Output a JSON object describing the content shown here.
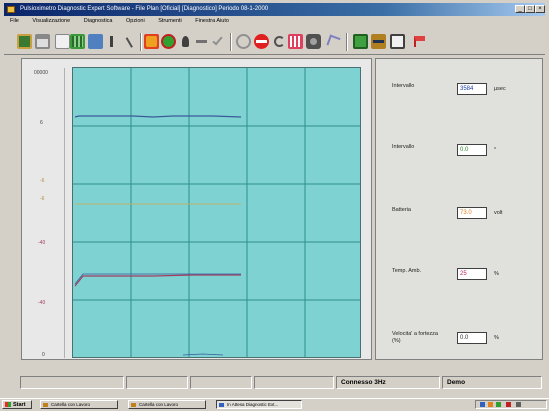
{
  "window": {
    "title": "Pulsioximetro Diagnostic Expert Software - File Plan [Oficial] [Diagnostico] Periodo 08-1-2000",
    "controls": [
      "_",
      "□",
      "×"
    ]
  },
  "menubar": [
    "File",
    "Visualizzazione",
    "Diagnostica",
    "Opzioni",
    "Strumenti",
    "Finestra Aiuto"
  ],
  "toolbar": {
    "icons": [
      "save-icon",
      "print-icon",
      "open-icon",
      "table-icon",
      "grid-icon",
      "filter-icon",
      "pen-icon",
      "record-icon",
      "globe-icon",
      "run-icon",
      "minus-icon",
      "check-icon",
      "zoom-icon",
      "stop-icon",
      "refresh-icon",
      "bar-icon",
      "camera-icon",
      "cursor-icon",
      "monitor-icon",
      "gear-icon",
      "book-icon",
      "flag-icon"
    ]
  },
  "plot": {
    "y_axis_labels": [
      "00000",
      "6",
      "-6",
      "-6",
      "-40",
      "-40",
      "0"
    ],
    "background": "#7fd2d2",
    "grid_color": "#2e8f8f",
    "trace_colors": [
      "#3a5a9a",
      "#c8b060",
      "#a04060",
      "#3a5a9a"
    ]
  },
  "panel": {
    "fields": [
      {
        "label": "Intervallo",
        "value": "3584",
        "unit": "µsec",
        "color": "#1a3ca0"
      },
      {
        "label": "Intervallo",
        "value": "0.0",
        "unit": "°",
        "color": "#2a8a2a"
      },
      {
        "label": "Batteria",
        "value": "73.0",
        "unit": "volt",
        "color": "#e08020"
      },
      {
        "label": "Temp. Amb.",
        "value": "25",
        "unit": "%",
        "color": "#c02060"
      },
      {
        "label": "Velocita' a fortezza\n(%)",
        "value": "0.0",
        "unit": "%",
        "color": "#333333"
      }
    ]
  },
  "status": {
    "cells": [
      "",
      "",
      "",
      "",
      "Connesso 3Hz",
      "Demo"
    ]
  },
  "taskbar": {
    "start": "Start",
    "tasks": [
      "Cartella con Lavoro",
      "Cartella con Lavoro",
      "In Attesa Diagnostic Ext..."
    ],
    "active_index": 2
  }
}
